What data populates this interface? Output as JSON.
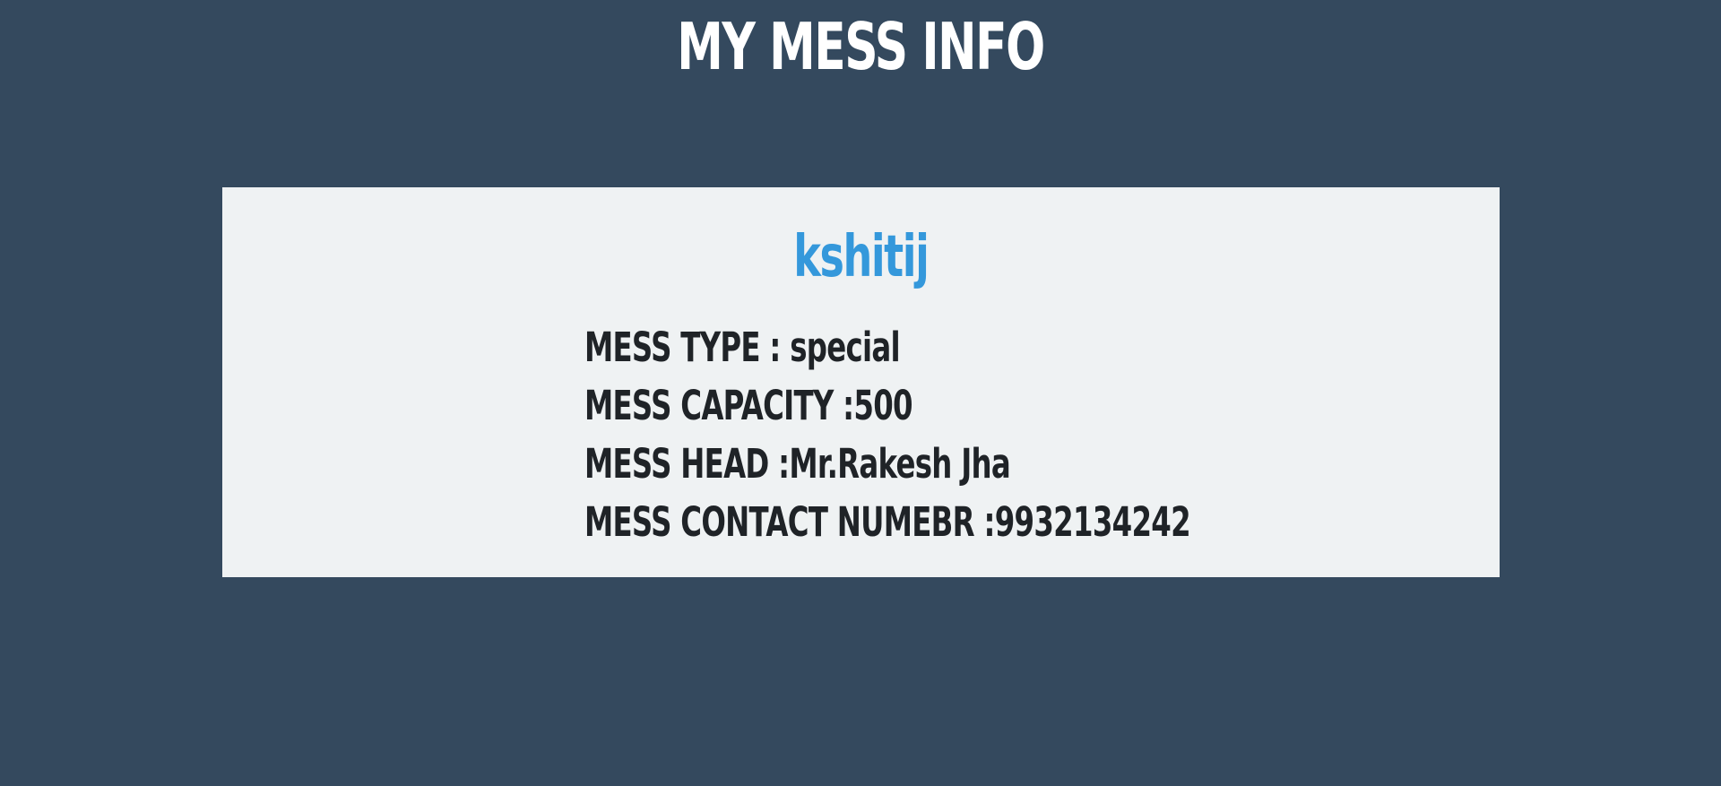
{
  "header": {
    "title": "MY MESS INFO"
  },
  "card": {
    "mess_name": "kshitij",
    "rows": [
      {
        "label": "MESS TYPE : ",
        "value": "special"
      },
      {
        "label": "MESS CAPACITY :",
        "value": "500"
      },
      {
        "label": "MESS HEAD :",
        "value": "Mr.Rakesh Jha"
      },
      {
        "label": "MESS CONTACT NUMEBR :",
        "value": "9932134242"
      }
    ]
  },
  "colors": {
    "background": "#34495e",
    "card": "#eff2f3",
    "accent": "#3498db",
    "text": "#1f2327",
    "title": "#ffffff"
  }
}
